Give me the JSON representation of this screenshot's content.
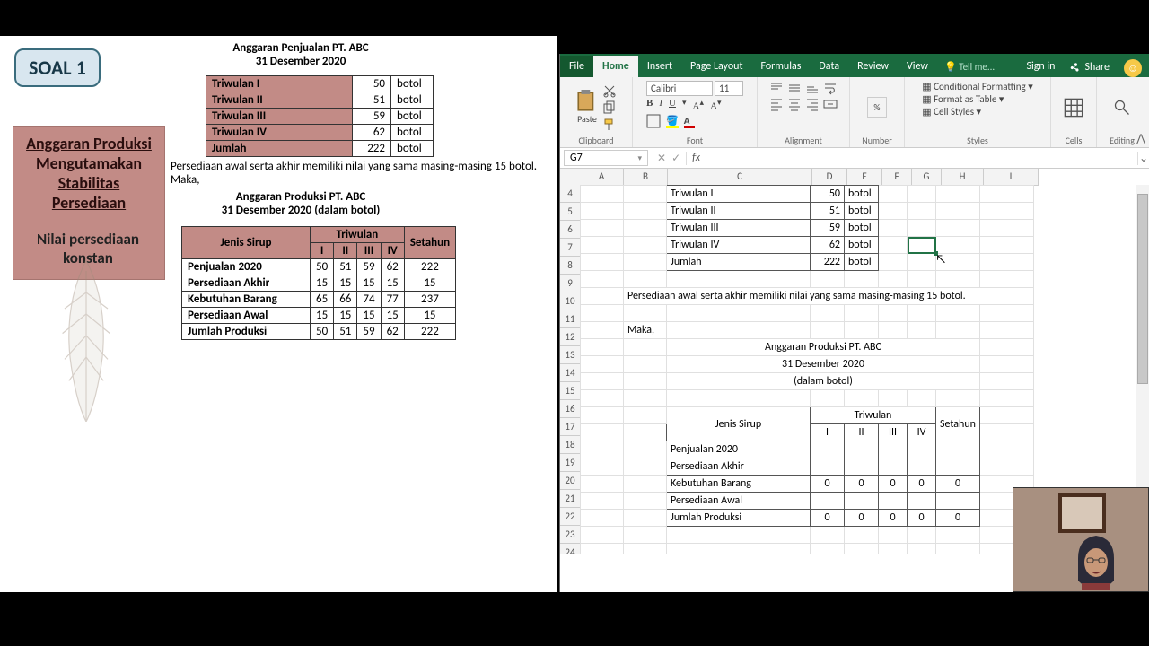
{
  "slide": {
    "badge": "SOAL 1",
    "prod_box_l1": "Anggaran Produksi",
    "prod_box_l2": "Mengutamakan",
    "prod_box_l3": "Stabilitas",
    "prod_box_l4": "Persediaan",
    "konstan_l1": "Nilai persediaan",
    "konstan_l2": "konstan",
    "penjualan_title_l1": "Anggaran Penjualan PT. ABC",
    "penjualan_title_l2": "31 Desember 2020",
    "penj_rows": [
      {
        "label": "Triwulan I",
        "val": "50",
        "unit": "botol"
      },
      {
        "label": "Triwulan II",
        "val": "51",
        "unit": "botol"
      },
      {
        "label": "Triwulan III",
        "val": "59",
        "unit": "botol"
      },
      {
        "label": "Triwulan IV",
        "val": "62",
        "unit": "botol"
      },
      {
        "label": "Jumlah",
        "val": "222",
        "unit": "botol"
      }
    ],
    "paragraph_l1": "Persediaan awal serta akhir memiliki nilai yang sama masing-masing 15 botol.",
    "paragraph_l2": "Maka,",
    "prod_title_l1": "Anggaran Produksi PT. ABC",
    "prod_title_l2": "31 Desember 2020 (dalam botol)",
    "prod_head_jenis": "Jenis Sirup",
    "prod_head_triwulan": "Triwulan",
    "prod_head_setahun": "Setahun",
    "prod_sub": [
      "I",
      "II",
      "III",
      "IV"
    ],
    "prod_rows": [
      {
        "label": "Penjualan 2020",
        "v": [
          "50",
          "51",
          "59",
          "62",
          "222"
        ]
      },
      {
        "label": "Persediaan Akhir",
        "v": [
          "15",
          "15",
          "15",
          "15",
          "15"
        ]
      },
      {
        "label": "Kebutuhan Barang",
        "v": [
          "65",
          "66",
          "74",
          "77",
          "237"
        ]
      },
      {
        "label": "Persediaan Awal",
        "v": [
          "15",
          "15",
          "15",
          "15",
          "15"
        ]
      },
      {
        "label": "Jumlah Produksi",
        "v": [
          "50",
          "51",
          "59",
          "62",
          "222"
        ]
      }
    ]
  },
  "excel": {
    "tabs": {
      "file": "File",
      "home": "Home",
      "insert": "Insert",
      "page": "Page Layout",
      "formulas": "Formulas",
      "data": "Data",
      "review": "Review",
      "view": "View",
      "tellme": "Tell me...",
      "signin": "Sign in",
      "share": "Share"
    },
    "ribbon": {
      "clipboard": "Clipboard",
      "paste": "Paste",
      "font": "Font",
      "font_name": "Calibri",
      "font_size": "11",
      "alignment": "Alignment",
      "number": "Number",
      "styles": "Styles",
      "cond": "Conditional Formatting",
      "fmt_table": "Format as Table",
      "cell_styles": "Cell Styles",
      "cells": "Cells",
      "editing": "Editing"
    },
    "namebox": "G7",
    "cols": [
      "A",
      "B",
      "C",
      "D",
      "E",
      "F",
      "G",
      "H",
      "I"
    ],
    "rows_start": 4,
    "rows_end": 25,
    "sheet": {
      "r4": {
        "C": "Triwulan I",
        "D": "50",
        "E": "botol"
      },
      "r5": {
        "C": "Triwulan II",
        "D": "51",
        "E": "botol"
      },
      "r6": {
        "C": "Triwulan III",
        "D": "59",
        "E": "botol"
      },
      "r7": {
        "C": "Triwulan IV",
        "D": "62",
        "E": "botol"
      },
      "r8": {
        "C": "Jumlah",
        "D": "222",
        "E": "botol"
      },
      "r10": {
        "B": "Persediaan awal serta akhir memiliki nilai yang sama masing-masing 15 botol."
      },
      "r12": {
        "B": "Maka,"
      },
      "r13": {
        "C": "Anggaran Produksi PT. ABC"
      },
      "r14": {
        "C": "31 Desember 2020"
      },
      "r15": {
        "C": "(dalam botol)"
      },
      "r17": {
        "C": "Jenis Sirup",
        "D": "Triwulan",
        "H": "Setahun"
      },
      "r18": {
        "D": "I",
        "E": "II",
        "F": "III",
        "G": "IV"
      },
      "r19": {
        "C": "Penjualan 2020"
      },
      "r20": {
        "C": "Persediaan Akhir"
      },
      "r21": {
        "C": "Kebutuhan Barang",
        "D": "0",
        "E": "0",
        "F": "0",
        "G": "0",
        "H": "0"
      },
      "r22": {
        "C": "Persediaan Awal"
      },
      "r23": {
        "C": "Jumlah Produksi",
        "D": "0",
        "E": "0",
        "F": "0",
        "G": "0",
        "H": "0"
      }
    }
  }
}
